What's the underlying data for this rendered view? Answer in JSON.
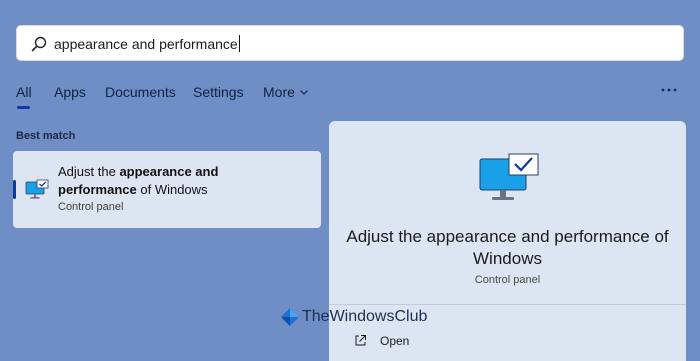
{
  "search": {
    "query": "appearance and performance",
    "icon": "search-icon"
  },
  "tabs": [
    {
      "label": "All",
      "active": true
    },
    {
      "label": "Apps"
    },
    {
      "label": "Documents"
    },
    {
      "label": "Settings"
    },
    {
      "label": "More"
    }
  ],
  "best_match": {
    "section_label": "Best match",
    "title_pre": "Adjust the ",
    "title_bold_1": "appearance and",
    "title_bold_2": "performance",
    "title_post": " of Windows",
    "subtitle": "Control panel",
    "icon": "monitor-check-icon"
  },
  "detail": {
    "title": "Adjust the appearance and performance of Windows",
    "subtitle": "Control panel",
    "open_label": "Open",
    "icon": "monitor-check-icon"
  },
  "watermark": {
    "text": "TheWindowsClub"
  },
  "colors": {
    "background": "#6f8ec6",
    "card": "#dee5f2",
    "accent": "#0b3c9c",
    "icon_blue": "#1aa0e6"
  }
}
